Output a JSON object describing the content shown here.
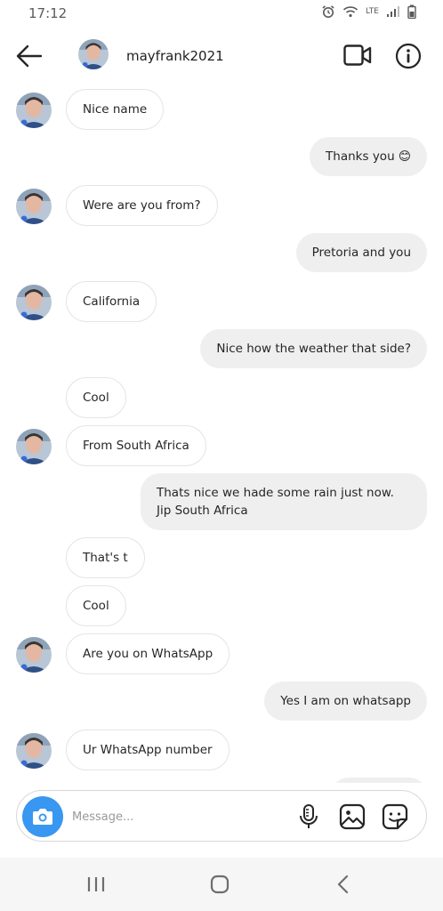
{
  "status": {
    "time": "17:12",
    "network": "LTE"
  },
  "header": {
    "username": "mayfrank2021"
  },
  "messages": [
    {
      "from": "them",
      "text": "Nice name"
    },
    {
      "from": "me",
      "text": "Thanks you 😊"
    },
    {
      "from": "them",
      "text": "Were are you from?"
    },
    {
      "from": "me",
      "text": "Pretoria and you"
    },
    {
      "from": "them",
      "text": "California"
    },
    {
      "from": "me",
      "text": "Nice how the weather that side?"
    },
    {
      "from": "them",
      "text": "Cool"
    },
    {
      "from": "them",
      "text": "From South Africa"
    },
    {
      "from": "me",
      "text": "Thats nice we hade some rain just now. Jip South Africa"
    },
    {
      "from": "them",
      "text": "That's t"
    },
    {
      "from": "them",
      "text": "Cool"
    },
    {
      "from": "them",
      "text": "Are you on WhatsApp"
    },
    {
      "from": "me",
      "text": "Yes I am on whatsapp"
    },
    {
      "from": "them",
      "text": "Ur WhatsApp number"
    }
  ],
  "composer": {
    "placeholder": "Message..."
  },
  "colors": {
    "accent": "#3897f0",
    "outgoing_bubble": "#efefef",
    "incoming_border": "#e5e5e5"
  },
  "icons": {
    "back": "arrow-left-icon",
    "video": "video-camera-icon",
    "info": "info-icon",
    "camera": "camera-icon",
    "mic": "microphone-icon",
    "gallery": "image-icon",
    "sticker": "sticker-icon"
  }
}
